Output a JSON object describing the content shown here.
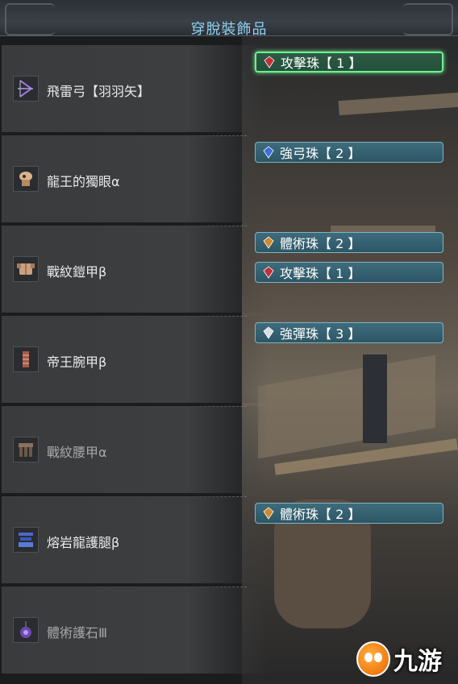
{
  "title": "穿脫裝飾品",
  "equipment": [
    {
      "name": "飛雷弓【羽羽矢】",
      "icon": "bow-icon",
      "dim": false,
      "decorations": [
        {
          "label": "攻擊珠【 1 】",
          "gem": "red-gem-icon",
          "selected": true
        }
      ]
    },
    {
      "name": "龍王的獨眼α",
      "icon": "helm-icon",
      "dim": false,
      "decorations": [
        {
          "label": "強弓珠【 2 】",
          "gem": "blue-gem-icon",
          "selected": false
        }
      ]
    },
    {
      "name": "戰紋鎧甲β",
      "icon": "chest-armor-icon",
      "dim": false,
      "decorations": [
        {
          "label": "體術珠【 2 】",
          "gem": "orange-gem-icon",
          "selected": false
        },
        {
          "label": "攻擊珠【 1 】",
          "gem": "red-gem-icon",
          "selected": false
        }
      ]
    },
    {
      "name": "帝王腕甲β",
      "icon": "arm-armor-icon",
      "dim": false,
      "decorations": [
        {
          "label": "強彈珠【 3 】",
          "gem": "white-gem-icon",
          "selected": false
        }
      ]
    },
    {
      "name": "戰紋腰甲α",
      "icon": "waist-armor-icon",
      "dim": true,
      "decorations": []
    },
    {
      "name": "熔岩龍護腿β",
      "icon": "leg-armor-icon",
      "dim": false,
      "decorations": [
        {
          "label": "體術珠【 2 】",
          "gem": "orange-gem-icon",
          "selected": false
        }
      ]
    },
    {
      "name": "體術護石Ⅲ",
      "icon": "charm-icon",
      "dim": true,
      "decorations": []
    }
  ],
  "gem_colors": {
    "red-gem-icon": "#c0303a",
    "blue-gem-icon": "#3a6fd8",
    "orange-gem-icon": "#d08a2a",
    "white-gem-icon": "#d8dde2"
  },
  "logo": {
    "text": "九游",
    "icon": "jiuyou-logo-icon"
  }
}
